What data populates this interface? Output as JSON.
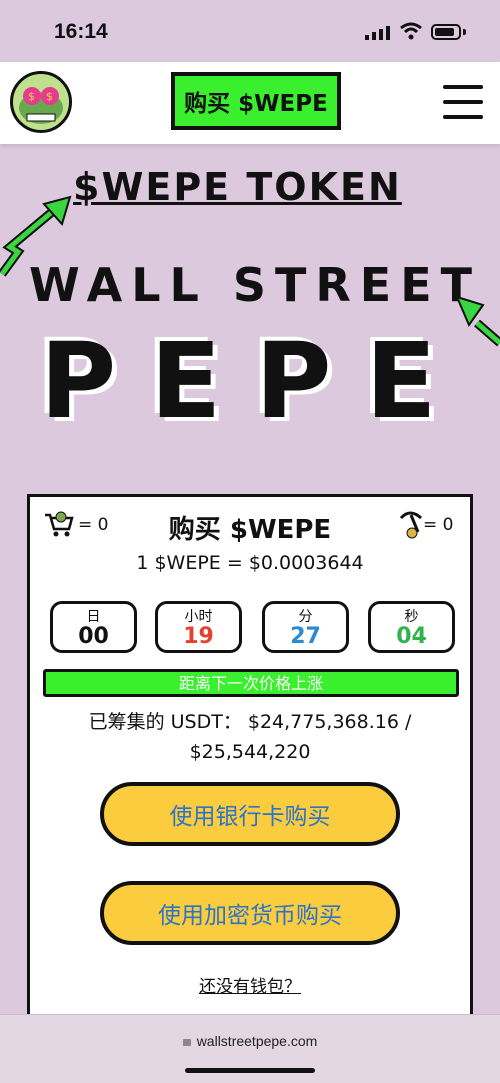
{
  "status": {
    "time": "16:14"
  },
  "nav": {
    "buy_label": "购买 $WEPE"
  },
  "hero": {
    "token_title": "$WEPE TOKEN",
    "wall_street": "WALL STREET",
    "pepe": "PEPE"
  },
  "card": {
    "cart_count": "= 0",
    "title": "购买 $WEPE",
    "pick_count": "= 0",
    "price": "1 $WEPE = $0.0003644",
    "timers": [
      {
        "label": "日",
        "value": "00",
        "color": "#111111"
      },
      {
        "label": "小时",
        "value": "19",
        "color": "#e2422e"
      },
      {
        "label": "分",
        "value": "27",
        "color": "#2b8ad8"
      },
      {
        "label": "秒",
        "value": "04",
        "color": "#2fb34a"
      }
    ],
    "progress_text": "距离下一次价格上涨",
    "progress_fraction": 1.0,
    "raised_line1": "已筹集的 USDT： $24,775,368.16 /",
    "raised_line2": "$25,544,220",
    "bank_button": "使用银行卡购买",
    "crypto_button": "使用加密货币购买",
    "wallet_link": "还没有钱包？"
  },
  "browser": {
    "url": "wallstreetpepe.com"
  },
  "colors": {
    "bg": "#dcc9dd",
    "green": "#39ef2e",
    "yellow": "#fbcc3e",
    "blue_text": "#2b74c8"
  }
}
